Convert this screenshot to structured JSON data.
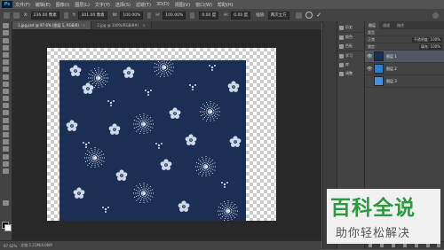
{
  "menubar": {
    "logo": "Ps",
    "items": [
      "文件(F)",
      "编辑(E)",
      "图像(I)",
      "图层(L)",
      "文字(Y)",
      "选择(S)",
      "滤镜(T)",
      "3D(D)",
      "视图(V)",
      "窗口(W)",
      "帮助(H)"
    ]
  },
  "optionsbar": {
    "x_label": "X:",
    "x_value": "236.00 像素",
    "y_label": "Y:",
    "y_value": "301.00 像素",
    "w_label": "W:",
    "w_value": "100.00%",
    "h_label": "H:",
    "h_value": "100.00%",
    "angle_value": "0.00 度",
    "h_skew_label": "H:",
    "h_skew_value": "0.00 度",
    "interpolation_label": "插值:",
    "interpolation_value": "两次立方"
  },
  "tabs": [
    {
      "label": "1.jpg.psd @ 97.6% (图层 1, RGB/8)",
      "close": "×"
    },
    {
      "label": "2.jpg @ 100%(RGB/8#)",
      "close": "×"
    }
  ],
  "status": {
    "zoom": "97.62%",
    "doc_info": "文档:1.21M/4.06M"
  },
  "mini_panels": [
    {
      "label": "历史",
      "icon": "history-icon"
    },
    {
      "label": "颜色",
      "icon": "color-icon"
    },
    {
      "label": "色板",
      "icon": "swatches-icon"
    },
    {
      "label": "学习",
      "icon": "learn-icon"
    },
    {
      "label": "库",
      "icon": "libraries-icon"
    },
    {
      "label": "调整",
      "icon": "adjustments-icon"
    }
  ],
  "layers_panel": {
    "tabs": [
      "图层",
      "通道",
      "路径"
    ],
    "kind_label": "类型",
    "blend_mode": "正常",
    "opacity_label": "不透明度: 100%",
    "lock_label": "锁定:",
    "fill_label": "填充: 100%",
    "layers": [
      {
        "name": "图层 1",
        "selected": true,
        "thumb_color": "#1b2f55"
      },
      {
        "name": "图层 2",
        "selected": false,
        "thumb_color": "#2a7fd0"
      },
      {
        "name": "图层 3",
        "selected": false,
        "thumb_color": "#4a8fd8"
      }
    ]
  },
  "colors": {
    "accent": "#31a8ff",
    "fabric": "#1b2f55",
    "watermark_green": "#2c9a3e"
  },
  "watermark": {
    "title": "百科全说",
    "subtitle": "助你轻松解决"
  }
}
